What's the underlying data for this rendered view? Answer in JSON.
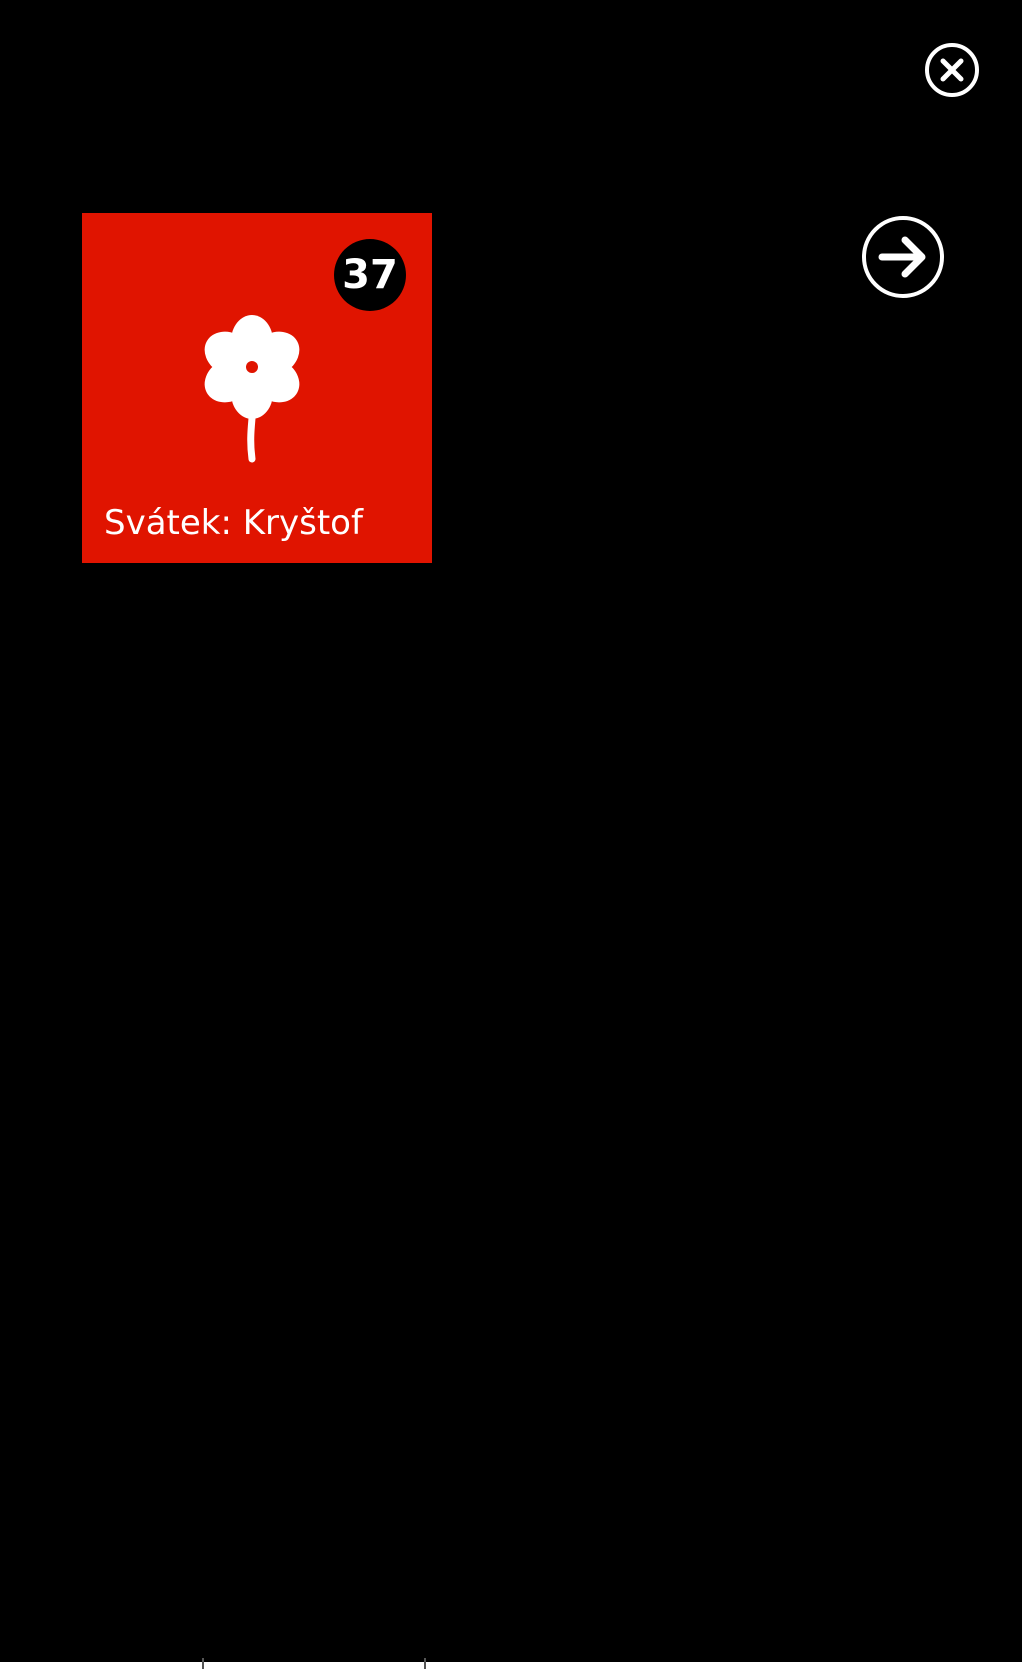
{
  "tile": {
    "badge_count": "37",
    "label": "Svátek: Kryštof",
    "icon": "flower-icon",
    "color": "#e01400"
  },
  "controls": {
    "close_icon": "close-circle-icon",
    "next_icon": "arrow-right-circle-icon"
  },
  "colors": {
    "background": "#000000",
    "foreground": "#ffffff"
  }
}
